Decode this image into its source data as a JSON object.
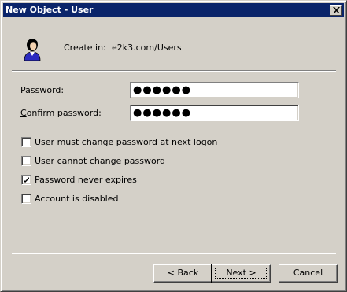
{
  "window": {
    "title": "New Object - User"
  },
  "header": {
    "create_in_label": "Create in:",
    "create_in_path": "e2k3.com/Users",
    "icon": "user-icon"
  },
  "fields": {
    "password_label": "Password:",
    "password_value": "●●●●●●",
    "confirm_label": "Confirm password:",
    "confirm_value": "●●●●●●"
  },
  "options": [
    {
      "label": "User must change password at next logon",
      "checked": false
    },
    {
      "label": "User cannot change password",
      "checked": false
    },
    {
      "label": "Password never expires",
      "checked": true
    },
    {
      "label": "Account is disabled",
      "checked": false
    }
  ],
  "buttons": {
    "back": "< Back",
    "next": "Next >",
    "cancel": "Cancel"
  },
  "colors": {
    "titlebar": "#0a246a",
    "face": "#d4d0c8"
  }
}
